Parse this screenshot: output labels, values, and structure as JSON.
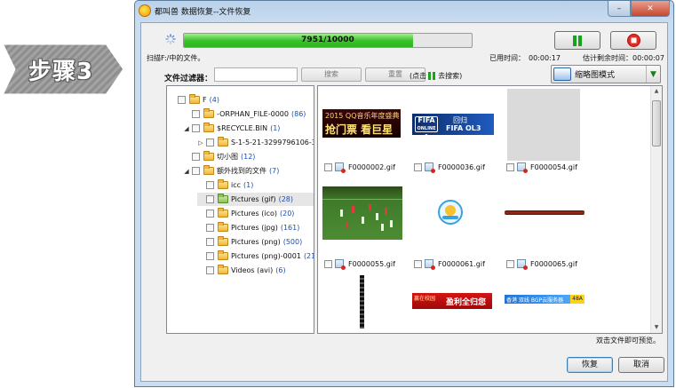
{
  "step_badge": {
    "label": "步骤3"
  },
  "window": {
    "title": "都叫兽 数据恢复--文件恢复"
  },
  "progress": {
    "text": "7951/10000",
    "current": 7951,
    "total": 10000
  },
  "status": {
    "scanning": "扫描F:/中的文件。",
    "elapsed_label": "已用时间：",
    "elapsed_value": "00:00:17",
    "remaining_label": "估计剩余时间：",
    "remaining_value": "00:00:07"
  },
  "filter": {
    "label": "文件过滤器：",
    "input_value": "",
    "search_label": "搜索",
    "reset_label": "重置",
    "hint_prefix": "(点击",
    "hint_suffix": "去搜索)"
  },
  "view_mode": {
    "selected": "缩略图模式"
  },
  "tree": {
    "items": [
      {
        "label": "F",
        "count": "(4)",
        "level": 0,
        "expander": "",
        "folder": "open"
      },
      {
        "label": "-ORPHAN_FILE-0000",
        "count": "(86)",
        "level": 1,
        "expander": "",
        "folder": "normal"
      },
      {
        "label": "$RECYCLE.BIN",
        "count": "(1)",
        "level": 1,
        "expander": "◢",
        "folder": "normal"
      },
      {
        "label": "S-1-5-21-3299796106-3",
        "count": "",
        "level": 2,
        "expander": "▷",
        "folder": "normal"
      },
      {
        "label": "切小图",
        "count": "(12)",
        "level": 1,
        "expander": "",
        "folder": "normal"
      },
      {
        "label": "额外找到的文件",
        "count": "(7)",
        "level": 1,
        "expander": "◢",
        "folder": "open"
      },
      {
        "label": "icc",
        "count": "(1)",
        "level": 2,
        "expander": "",
        "folder": "normal"
      },
      {
        "label": "Pictures (gif)",
        "count": "(28)",
        "level": 2,
        "expander": "",
        "folder": "green",
        "selected": true
      },
      {
        "label": "Pictures (ico)",
        "count": "(20)",
        "level": 2,
        "expander": "",
        "folder": "normal"
      },
      {
        "label": "Pictures (jpg)",
        "count": "(161)",
        "level": 2,
        "expander": "",
        "folder": "normal"
      },
      {
        "label": "Pictures (png)",
        "count": "(500)",
        "level": 2,
        "expander": "",
        "folder": "normal"
      },
      {
        "label": "Pictures (png)-0001",
        "count": "(21",
        "level": 2,
        "expander": "",
        "folder": "normal"
      },
      {
        "label": "Videos (avi)",
        "count": "(6)",
        "level": 2,
        "expander": "",
        "folder": "normal"
      }
    ]
  },
  "thumbnails": {
    "items": [
      {
        "name": "F0000002.gif",
        "kind": "qq-banner",
        "line1": "2015 QQ音乐年度盛典",
        "line2": "抢门票 看巨星"
      },
      {
        "name": "F0000036.gif",
        "kind": "fifa-banner",
        "brand": "FIFA",
        "sub": "ONLINE 3",
        "line1": "回归",
        "line2": "FIFA OL3"
      },
      {
        "name": "F0000054.gif",
        "kind": "gray-image"
      },
      {
        "name": "F0000055.gif",
        "kind": "soccer-photo"
      },
      {
        "name": "F0000061.gif",
        "kind": "badge-icon"
      },
      {
        "name": "F0000065.gif",
        "kind": "thin-bar"
      },
      {
        "name": "",
        "kind": "vertical-strip"
      },
      {
        "name": "",
        "kind": "promo-banner",
        "line1": "赢在校园",
        "line2": "盈利全归您"
      },
      {
        "name": "",
        "kind": "cloud-banner",
        "line1": "香港 双线 BGP云服务器",
        "tag": "48A"
      }
    ]
  },
  "footer": {
    "hint": "双击文件即可预览。",
    "recover_label": "恢复",
    "cancel_label": "取消"
  }
}
